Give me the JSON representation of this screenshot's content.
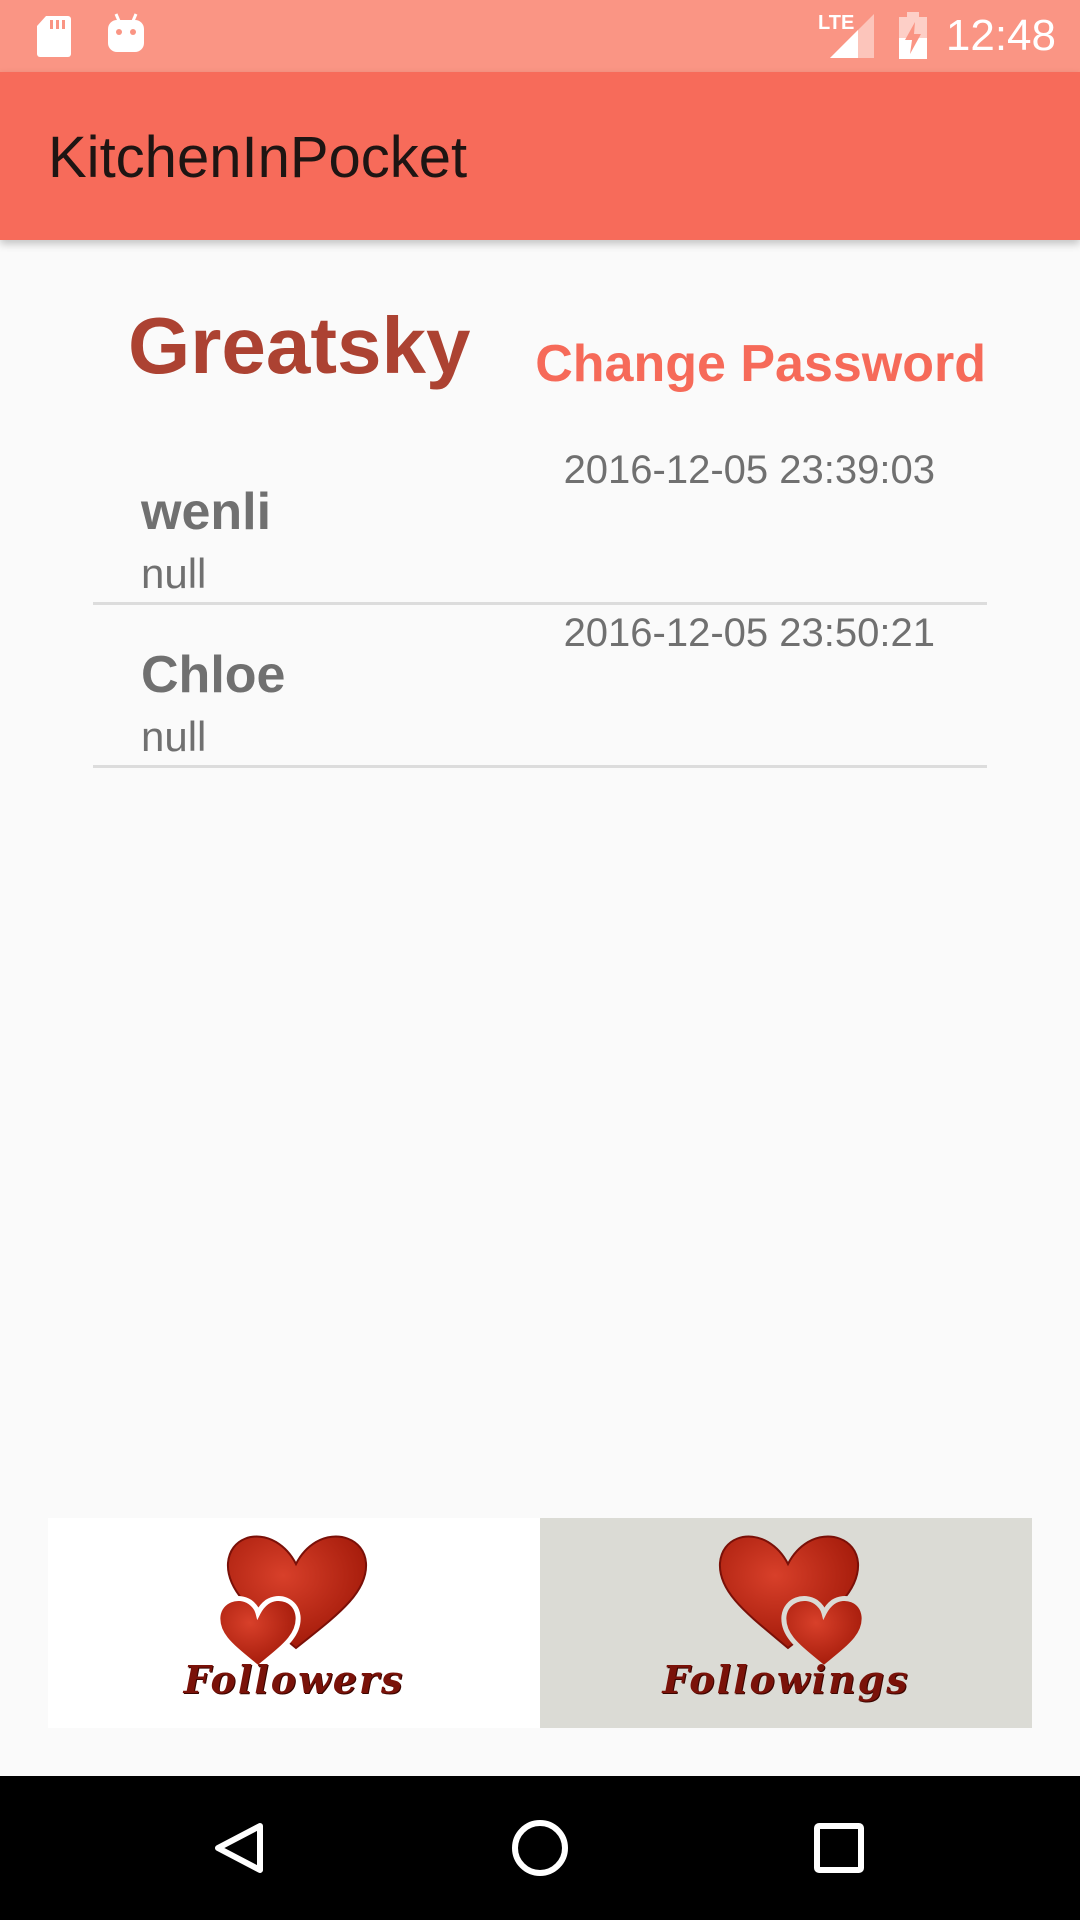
{
  "status_bar": {
    "time": "12:48",
    "network_label": "LTE",
    "icons": [
      "sd-card-icon",
      "android-debug-icon",
      "lte-signal-icon",
      "battery-charging-icon"
    ]
  },
  "app_bar": {
    "title": "KitchenInPocket"
  },
  "profile": {
    "username": "Greatsky",
    "change_password_label": "Change Password"
  },
  "list": {
    "items": [
      {
        "name": "wenli",
        "message": "null",
        "timestamp": "2016-12-05 23:39:03"
      },
      {
        "name": "Chloe",
        "message": "null",
        "timestamp": "2016-12-05 23:50:21"
      }
    ]
  },
  "tabs": {
    "followers_label": "Followers",
    "followings_label": "Followings",
    "selected": "followers"
  },
  "nav_bar": {
    "icons": [
      "back-icon",
      "home-icon",
      "recents-icon"
    ]
  },
  "colors": {
    "status_bar": "#fa9584",
    "app_bar": "#f76b5a",
    "username": "#ac4232",
    "accent": "#f66a59",
    "heart": "#b01e0c"
  }
}
